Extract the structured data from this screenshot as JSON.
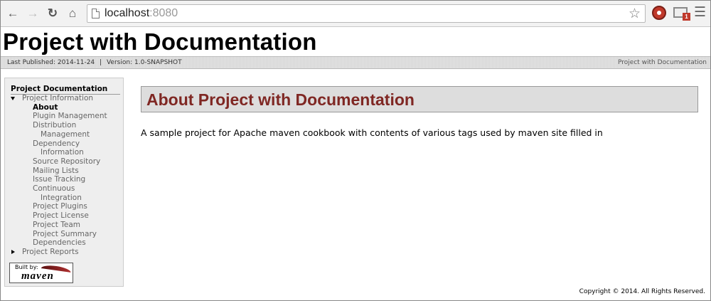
{
  "browser": {
    "back_icon": "arrow-left-icon",
    "forward_icon": "arrow-right-icon",
    "reload_icon": "reload-icon",
    "home_icon": "home-icon",
    "url_host": "localhost",
    "url_port": ":8080",
    "bookmark_icon": "star-icon",
    "menu_icon": "hamburger-menu-icon",
    "extension_badge": "1"
  },
  "site": {
    "title": "Project with Documentation",
    "last_published_label": "Last Published:",
    "last_published": "2014-11-24",
    "separator": "|",
    "version_label": "Version:",
    "version": "1.0-SNAPSHOT",
    "breadcrumb_right": "Project with Documentation"
  },
  "sidebar": {
    "heading": "Project Documentation",
    "items": [
      {
        "label": "Project Information"
      },
      {
        "label": "About"
      },
      {
        "label": "Plugin Management"
      },
      {
        "label": "Distribution"
      },
      {
        "label": "Management"
      },
      {
        "label": "Dependency"
      },
      {
        "label": "Information"
      },
      {
        "label": "Source Repository"
      },
      {
        "label": "Mailing Lists"
      },
      {
        "label": "Issue Tracking"
      },
      {
        "label": "Continuous"
      },
      {
        "label": "Integration"
      },
      {
        "label": "Project Plugins"
      },
      {
        "label": "Project License"
      },
      {
        "label": "Project Team"
      },
      {
        "label": "Project Summary"
      },
      {
        "label": "Dependencies"
      },
      {
        "label": "Project Reports"
      }
    ],
    "badge_top": "Built by:",
    "badge_main": "maven"
  },
  "main": {
    "section_title": "About Project with Documentation",
    "description": "A sample project for Apache maven cookbook with contents of various tags used by maven site filled in"
  },
  "footer": {
    "copyright": "Copyright © 2014. All Rights Reserved."
  }
}
